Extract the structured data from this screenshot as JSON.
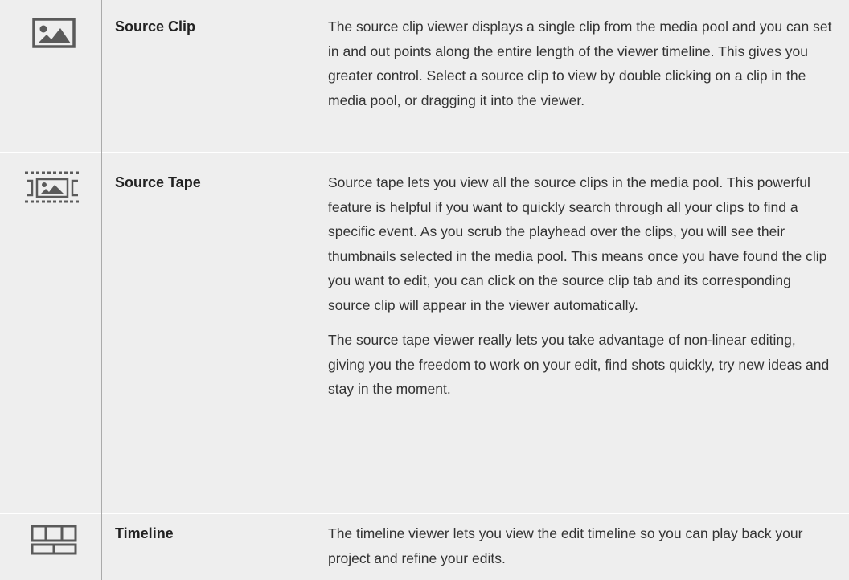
{
  "rows": [
    {
      "icon": "source-clip-icon",
      "name": "Source Clip",
      "description": [
        "The source clip viewer displays a single clip from the media pool and you can set in and out points along the entire length of the viewer timeline. This gives you greater control. Select a source clip to view by double clicking on a clip in the media pool, or dragging it into the viewer."
      ]
    },
    {
      "icon": "source-tape-icon",
      "name": "Source Tape",
      "description": [
        "Source tape lets you view all the source clips in the media pool. This powerful feature is helpful if you want to quickly search through all your clips to find a specific event. As you scrub the playhead over the clips, you will see their thumbnails selected in the media pool. This means once you have found the clip you want to edit, you can click on the source clip tab and its corresponding source clip will appear in the viewer automatically.",
        "The source tape viewer really lets you take advantage of non-linear editing, giving you the freedom to work on your edit, find shots quickly, try new ideas and stay in the moment."
      ]
    },
    {
      "icon": "timeline-icon",
      "name": "Timeline",
      "description": [
        "The timeline viewer lets you view the edit timeline so you can play back your project and refine your edits."
      ]
    }
  ]
}
